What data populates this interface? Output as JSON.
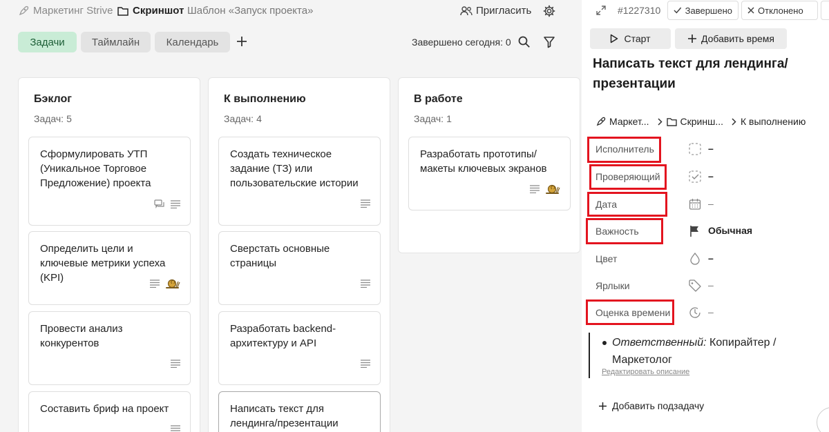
{
  "header": {
    "project": "Маркетинг Strive",
    "folder": "Скриншот",
    "template": "Шаблон «Запуск проекта»",
    "invite_label": "Пригласить"
  },
  "views": {
    "tabs": [
      "Задачи",
      "Таймлайн",
      "Календарь"
    ],
    "active": "Задачи",
    "done_today": "Завершено сегодня: 0"
  },
  "columns": [
    {
      "title": "Бэклог",
      "count_label": "Задач:",
      "count": "5",
      "cards": [
        {
          "text": "Сформулировать УТП (Уникальное Торговое Предложение) проекта",
          "icons": [
            "comment-icon",
            "description-icon"
          ]
        },
        {
          "text": "Определить цели и ключевые метрики успеха (KPI)",
          "icons": [
            "description-icon",
            "snail-icon"
          ]
        },
        {
          "text": "Провести анализ конкурентов",
          "icons": [
            "description-icon"
          ]
        },
        {
          "text": "Составить бриф на проект",
          "icons": [
            "description-icon"
          ]
        }
      ]
    },
    {
      "title": "К выполнению",
      "count_label": "Задач:",
      "count": "4",
      "cards": [
        {
          "text": "Создать техническое задание (ТЗ) или пользовательские истории",
          "icons": [
            "description-icon"
          ]
        },
        {
          "text": "Сверстать основные страницы",
          "icons": [
            "description-icon"
          ]
        },
        {
          "text": "Разработать backend-архитектуру и API",
          "icons": [
            "description-icon"
          ]
        },
        {
          "text": "Написать текст для лендинга/презентации",
          "icons": []
        }
      ]
    },
    {
      "title": "В работе",
      "count_label": "Задач:",
      "count": "1",
      "cards": [
        {
          "text": "Разработать прототипы/ макеты ключевых экранов",
          "icons": [
            "description-icon",
            "snail-icon"
          ]
        }
      ]
    }
  ],
  "task_panel": {
    "id": "#1227310",
    "done_label": "Завершено",
    "rejected_label": "Отклонено",
    "start_label": "Старт",
    "add_time_label": "Добавить время",
    "title": "Написать текст для лендинга/ презентации",
    "path": [
      "Маркет...",
      "Скринш...",
      "К выполнению"
    ],
    "properties": [
      {
        "label": "Исполнитель",
        "value": "–",
        "icon": "assignee-icon"
      },
      {
        "label": "Проверяющий",
        "value": "–",
        "icon": "reviewer-icon"
      },
      {
        "label": "Дата",
        "value": "–",
        "icon": "calendar-icon"
      },
      {
        "label": "Важность",
        "value": "Обычная",
        "icon": "flag-icon"
      },
      {
        "label": "Цвет",
        "value": "–",
        "icon": "drop-icon"
      },
      {
        "label": "Ярлыки",
        "value": "–",
        "icon": "tag-icon"
      },
      {
        "label": "Оценка времени",
        "value": "–",
        "icon": "clock-icon"
      }
    ],
    "description": {
      "label": "Ответственный:",
      "text": "Копирайтер / Маркетолог"
    },
    "edit_description": "Редактировать описание",
    "add_subtask": "Добавить подзадачу"
  },
  "colors": {
    "active_tab_bg": "#c9ecd6",
    "highlight": "#e3141f"
  }
}
